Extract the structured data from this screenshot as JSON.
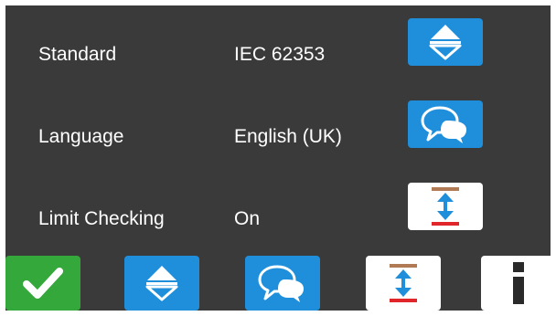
{
  "settings": {
    "rows": [
      {
        "label": "Standard",
        "value": "IEC 62353",
        "button_icon": "up-down-arrows-icon"
      },
      {
        "label": "Language",
        "value": "English (UK)",
        "button_icon": "speech-bubbles-icon"
      },
      {
        "label": "Limit Checking",
        "value": "On",
        "button_icon": "limit-range-icon"
      }
    ]
  },
  "bottom_bar": {
    "buttons": [
      {
        "icon": "checkmark-icon",
        "color": "#35a83c"
      },
      {
        "icon": "up-down-arrows-icon",
        "color": "#1f8fdb"
      },
      {
        "icon": "speech-bubbles-icon",
        "color": "#1f8fdb"
      },
      {
        "icon": "limit-range-icon",
        "color": "#ffffff"
      },
      {
        "icon": "info-icon",
        "color": "#ffffff"
      }
    ]
  },
  "colors": {
    "screen_background": "#3a3a3a",
    "text": "#ffffff",
    "accent_blue": "#1f8fdb",
    "ok_green": "#35a83c",
    "limit_top_bar": "#b07a55",
    "limit_bottom_bar": "#e0262b"
  }
}
